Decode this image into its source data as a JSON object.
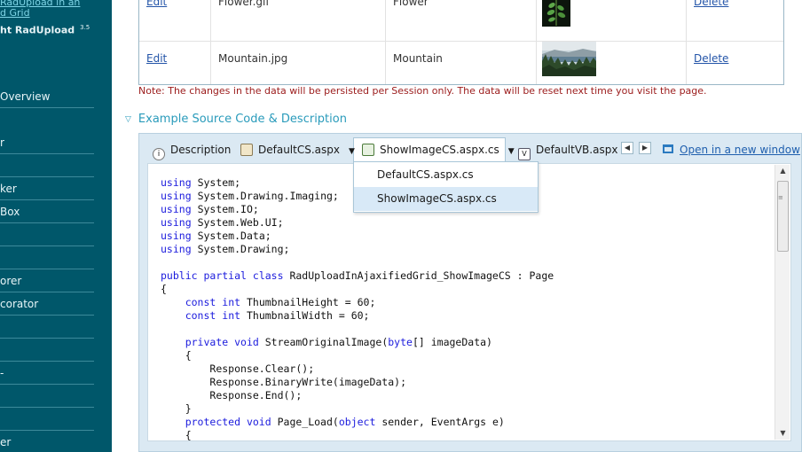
{
  "sidebar": {
    "link_line1": "RadUpload in an",
    "link_line2": "d Grid",
    "product": "ht RadUpload",
    "version": "3.5",
    "items": [
      {
        "label": " Overview"
      },
      {
        "label": "r"
      },
      {
        "label": ""
      },
      {
        "label": "ker"
      },
      {
        "label": "Box"
      },
      {
        "label": ""
      },
      {
        "label": ""
      },
      {
        "label": "orer"
      },
      {
        "label": "corator"
      },
      {
        "label": ""
      },
      {
        "label": ""
      },
      {
        "label": "-"
      },
      {
        "label": ""
      },
      {
        "label": ""
      },
      {
        "label": "er"
      }
    ]
  },
  "grid": {
    "rows": [
      {
        "edit": "Edit",
        "filename": "Flower.gif",
        "title": "Flower",
        "thumbnail": "leaf-image",
        "delete": "Delete"
      },
      {
        "edit": "Edit",
        "filename": "Mountain.jpg",
        "title": "Mountain",
        "thumbnail": "mountain-lake-image",
        "delete": "Delete"
      }
    ]
  },
  "note": "Note: The changes in the data will be persisted per Session only. The data will be reset next time you visit the page.",
  "section": {
    "title": "Example Source Code & Description"
  },
  "tabs": {
    "description": "Description",
    "defaultcs": "DefaultCS.aspx",
    "showimage": "ShowImageCS.aspx.cs",
    "defaultvb": "DefaultVB.aspx.vb",
    "open_new_window": "Open in a new window"
  },
  "dropdown": {
    "options": [
      "DefaultCS.aspx.cs",
      "ShowImageCS.aspx.cs"
    ],
    "selected": "ShowImageCS.aspx.cs"
  },
  "code": {
    "lines": [
      "using System;",
      "using System.Drawing.Imaging;",
      "using System.IO;",
      "using System.Web.UI;",
      "using System.Data;",
      "using System.Drawing;",
      "",
      "public partial class RadUploadInAjaxifiedGrid_ShowImageCS : Page",
      "{",
      "    const int ThumbnailHeight = 60;",
      "    const int ThumbnailWidth = 60;",
      "",
      "    private void StreamOriginalImage(byte[] imageData)",
      "    {",
      "        Response.Clear();",
      "        Response.BinaryWrite(imageData);",
      "        Response.End();",
      "    }",
      "    protected void Page_Load(object sender, EventArgs e)",
      "    {"
    ]
  },
  "colors": {
    "sidebar_bg": "#00576a",
    "link_blue": "#2354a8",
    "note_red": "#9b1b1b",
    "section_teal": "#2a9bbb",
    "keyword_blue": "#1b1bdd",
    "dropdown_selected": "#d8e9f7"
  }
}
